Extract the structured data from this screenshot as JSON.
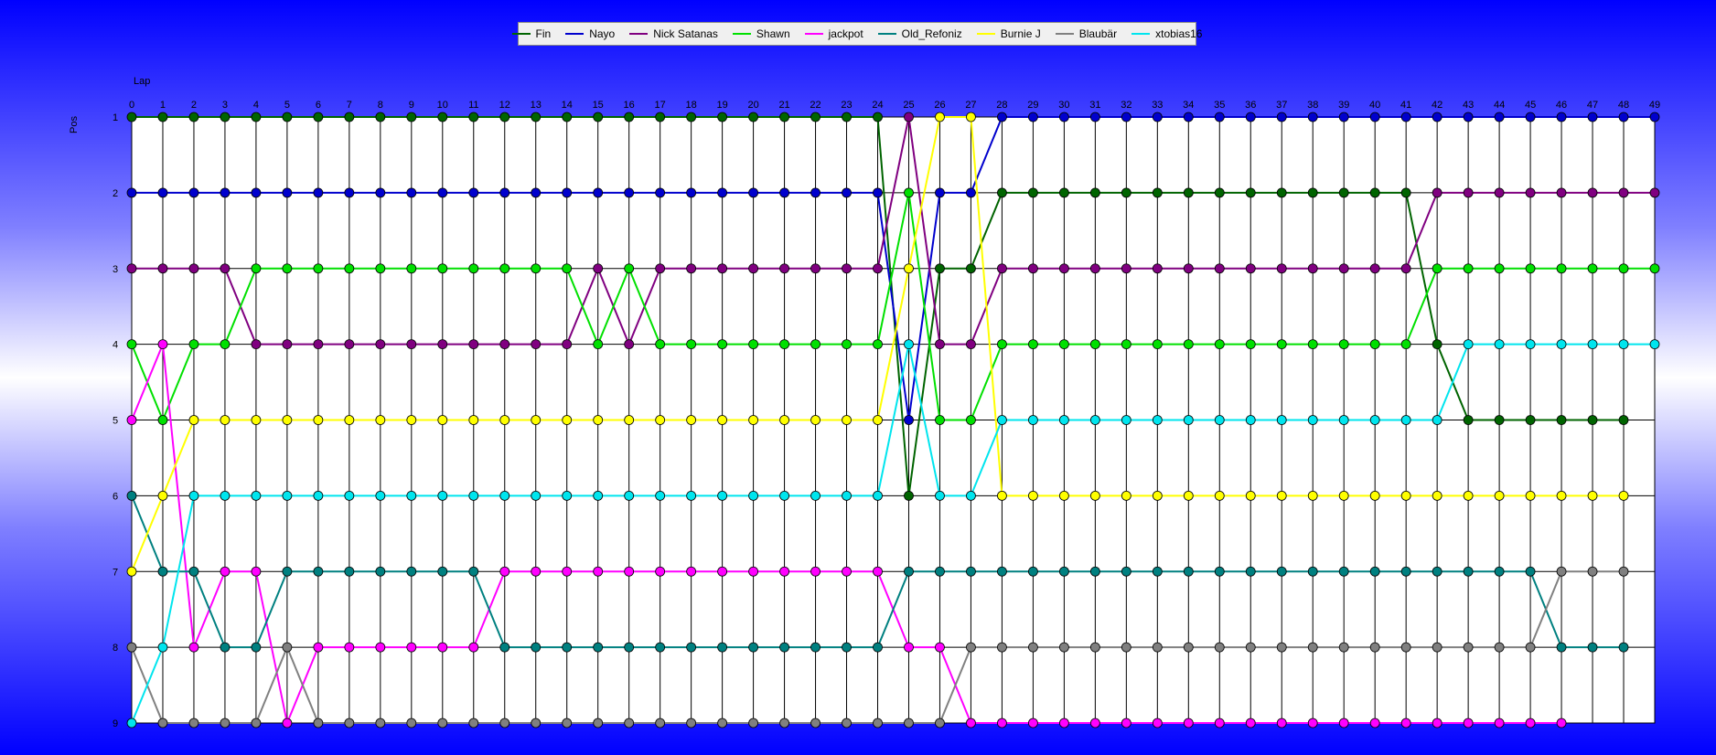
{
  "chart_data": {
    "type": "line",
    "xlabel": "Lap",
    "ylabel": "Pos",
    "xlim": [
      0,
      49
    ],
    "ylim": [
      1,
      9
    ],
    "y_inverted": true,
    "grid": true,
    "legend_position": "top-center",
    "x": [
      0,
      1,
      2,
      3,
      4,
      5,
      6,
      7,
      8,
      9,
      10,
      11,
      12,
      13,
      14,
      15,
      16,
      17,
      18,
      19,
      20,
      21,
      22,
      23,
      24,
      25,
      26,
      27,
      28,
      29,
      30,
      31,
      32,
      33,
      34,
      35,
      36,
      37,
      38,
      39,
      40,
      41,
      42,
      43,
      44,
      45,
      46,
      47,
      48,
      49
    ],
    "series": [
      {
        "name": "Fin",
        "color": "#006400",
        "values": [
          1,
          1,
          1,
          1,
          1,
          1,
          1,
          1,
          1,
          1,
          1,
          1,
          1,
          1,
          1,
          1,
          1,
          1,
          1,
          1,
          1,
          1,
          1,
          1,
          1,
          6,
          3,
          3,
          2,
          2,
          2,
          2,
          2,
          2,
          2,
          2,
          2,
          2,
          2,
          2,
          2,
          2,
          4,
          5,
          5,
          5,
          5,
          5,
          5
        ]
      },
      {
        "name": "Nayo",
        "color": "#0000cd",
        "values": [
          2,
          2,
          2,
          2,
          2,
          2,
          2,
          2,
          2,
          2,
          2,
          2,
          2,
          2,
          2,
          2,
          2,
          2,
          2,
          2,
          2,
          2,
          2,
          2,
          2,
          5,
          2,
          2,
          1,
          1,
          1,
          1,
          1,
          1,
          1,
          1,
          1,
          1,
          1,
          1,
          1,
          1,
          1,
          1,
          1,
          1,
          1,
          1,
          1,
          1
        ]
      },
      {
        "name": "Nick Satanas",
        "color": "#800080",
        "values": [
          3,
          3,
          3,
          3,
          4,
          4,
          4,
          4,
          4,
          4,
          4,
          4,
          4,
          4,
          4,
          3,
          4,
          3,
          3,
          3,
          3,
          3,
          3,
          3,
          3,
          1,
          4,
          4,
          3,
          3,
          3,
          3,
          3,
          3,
          3,
          3,
          3,
          3,
          3,
          3,
          3,
          3,
          2,
          2,
          2,
          2,
          2,
          2,
          2,
          2
        ]
      },
      {
        "name": "Shawn",
        "color": "#00e000",
        "values": [
          4,
          5,
          4,
          4,
          3,
          3,
          3,
          3,
          3,
          3,
          3,
          3,
          3,
          3,
          3,
          4,
          3,
          4,
          4,
          4,
          4,
          4,
          4,
          4,
          4,
          2,
          5,
          5,
          4,
          4,
          4,
          4,
          4,
          4,
          4,
          4,
          4,
          4,
          4,
          4,
          4,
          4,
          3,
          3,
          3,
          3,
          3,
          3,
          3,
          3
        ]
      },
      {
        "name": "jackpot",
        "color": "#ff00ff",
        "values": [
          5,
          4,
          8,
          7,
          7,
          9,
          8,
          8,
          8,
          8,
          8,
          8,
          7,
          7,
          7,
          7,
          7,
          7,
          7,
          7,
          7,
          7,
          7,
          7,
          7,
          8,
          8,
          9,
          9,
          9,
          9,
          9,
          9,
          9,
          9,
          9,
          9,
          9,
          9,
          9,
          9,
          9,
          9,
          9,
          9,
          9,
          9
        ]
      },
      {
        "name": "Old_Refoniz",
        "color": "#008080",
        "values": [
          6,
          7,
          7,
          8,
          8,
          7,
          7,
          7,
          7,
          7,
          7,
          7,
          8,
          8,
          8,
          8,
          8,
          8,
          8,
          8,
          8,
          8,
          8,
          8,
          8,
          7,
          7,
          7,
          7,
          7,
          7,
          7,
          7,
          7,
          7,
          7,
          7,
          7,
          7,
          7,
          7,
          7,
          7,
          7,
          7,
          7,
          8,
          8,
          8
        ]
      },
      {
        "name": "Burnie J",
        "color": "#ffff00",
        "values": [
          7,
          6,
          5,
          5,
          5,
          5,
          5,
          5,
          5,
          5,
          5,
          5,
          5,
          5,
          5,
          5,
          5,
          5,
          5,
          5,
          5,
          5,
          5,
          5,
          5,
          3,
          1,
          1,
          6,
          6,
          6,
          6,
          6,
          6,
          6,
          6,
          6,
          6,
          6,
          6,
          6,
          6,
          6,
          6,
          6,
          6,
          6,
          6,
          6
        ]
      },
      {
        "name": "Blaubär",
        "color": "#808080",
        "values": [
          8,
          9,
          9,
          9,
          9,
          8,
          9,
          9,
          9,
          9,
          9,
          9,
          9,
          9,
          9,
          9,
          9,
          9,
          9,
          9,
          9,
          9,
          9,
          9,
          9,
          9,
          9,
          8,
          8,
          8,
          8,
          8,
          8,
          8,
          8,
          8,
          8,
          8,
          8,
          8,
          8,
          8,
          8,
          8,
          8,
          8,
          7,
          7,
          7
        ]
      },
      {
        "name": "xtobias16",
        "color": "#00e5ee",
        "values": [
          9,
          8,
          6,
          6,
          6,
          6,
          6,
          6,
          6,
          6,
          6,
          6,
          6,
          6,
          6,
          6,
          6,
          6,
          6,
          6,
          6,
          6,
          6,
          6,
          6,
          4,
          6,
          6,
          5,
          5,
          5,
          5,
          5,
          5,
          5,
          5,
          5,
          5,
          5,
          5,
          5,
          5,
          5,
          4,
          4,
          4,
          4,
          4,
          4,
          4
        ]
      }
    ]
  }
}
